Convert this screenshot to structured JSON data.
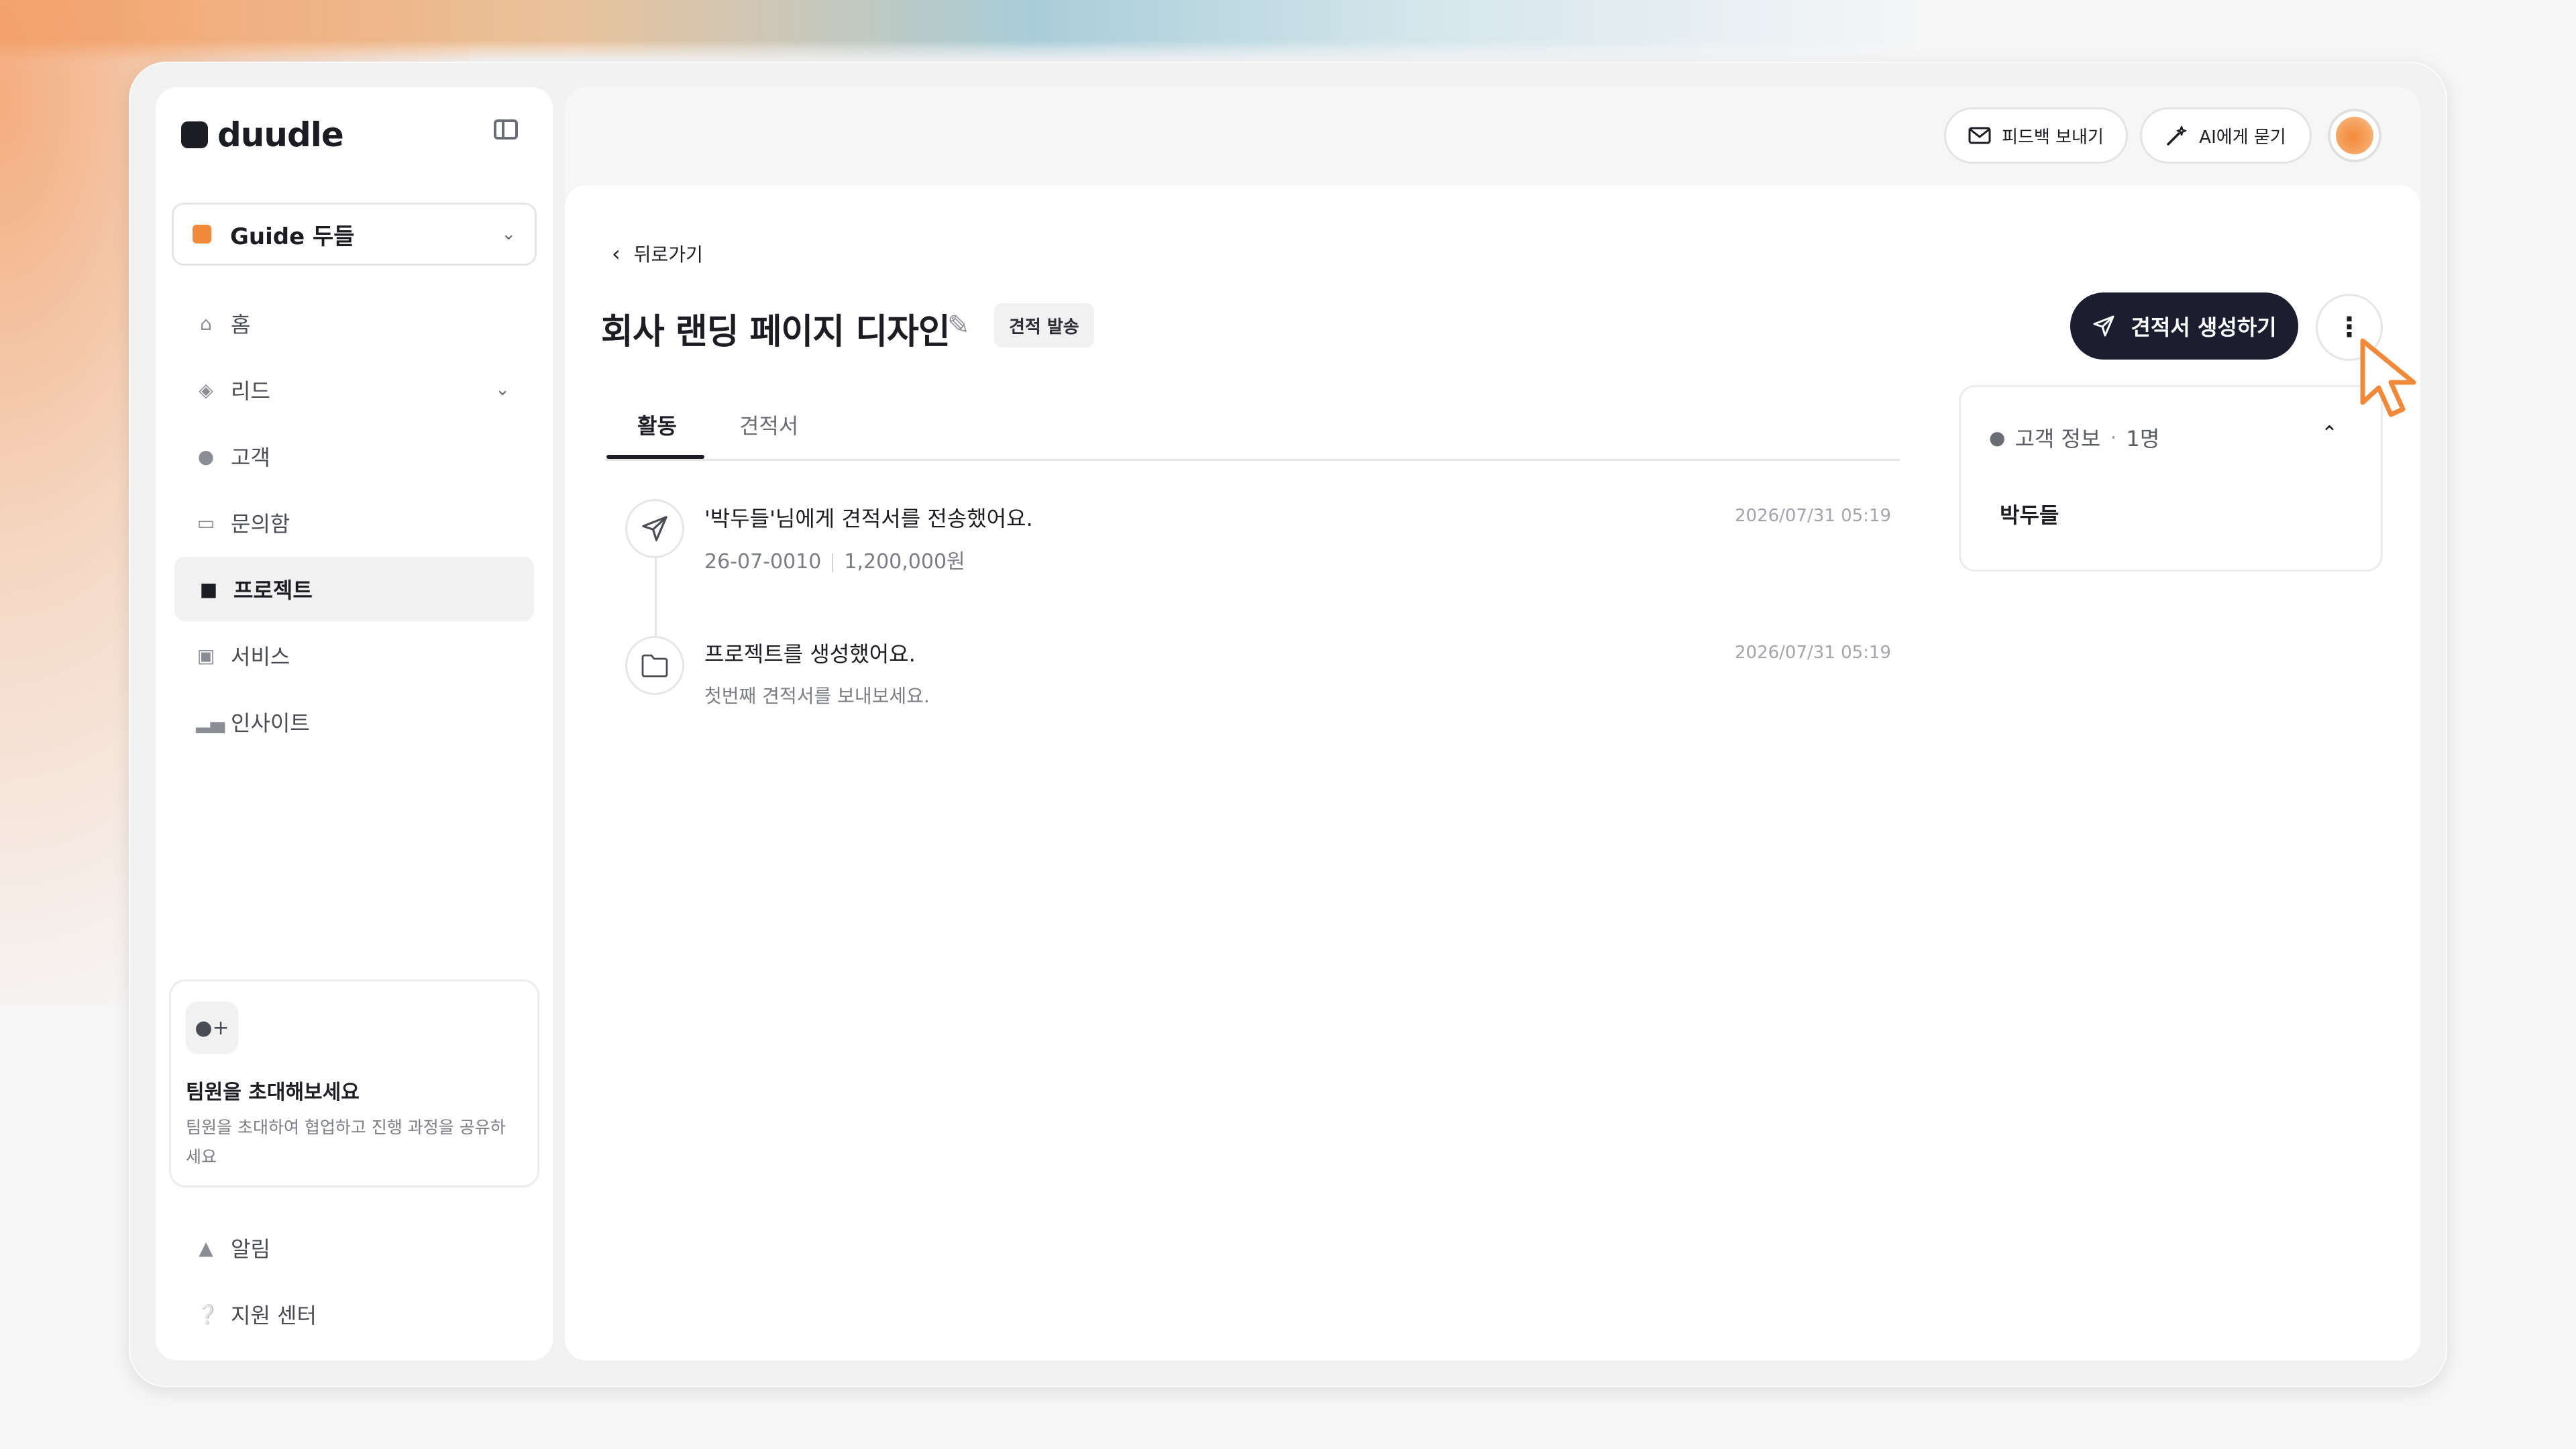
{
  "app": {
    "logo_text": "duudle"
  },
  "workspace": {
    "name": "Guide 두들",
    "accent": "#f08a3a"
  },
  "sidebar": {
    "items": [
      {
        "label": "홈",
        "icon": "home-icon"
      },
      {
        "label": "리드",
        "icon": "target-icon",
        "has_chevron": true
      },
      {
        "label": "고객",
        "icon": "person-icon"
      },
      {
        "label": "문의함",
        "icon": "inbox-icon"
      },
      {
        "label": "프로젝트",
        "icon": "folder-icon",
        "active": true
      },
      {
        "label": "서비스",
        "icon": "briefcase-icon"
      },
      {
        "label": "인사이트",
        "icon": "bar-chart-icon"
      }
    ],
    "invite": {
      "title": "팀원을 초대해보세요",
      "description": "팀원을 초대하여 협업하고 진행 과정을 공유하세요"
    },
    "bottom": [
      {
        "label": "알림",
        "icon": "bell-icon"
      },
      {
        "label": "지원 센터",
        "icon": "help-icon"
      }
    ]
  },
  "header": {
    "feedback_label": "피드백 보내기",
    "ai_label": "AI에게 묻기"
  },
  "page": {
    "back_label": "뒤로가기",
    "title": "회사 랜딩 페이지 디자인",
    "status_badge": "견적 발송",
    "primary_action": "견적서 생성하기"
  },
  "tabs": [
    {
      "label": "활동",
      "active": true
    },
    {
      "label": "견적서",
      "active": false
    }
  ],
  "activity": [
    {
      "icon": "send-icon",
      "title": "'박두들'님에게 견적서를 전송했어요.",
      "quote_no": "26-07-0010",
      "amount": "1,200,000원",
      "timestamp": "2026/07/31 05:19"
    },
    {
      "icon": "folder-icon",
      "title": "프로젝트를 생성했어요.",
      "subtitle": "첫번째 견적서를 보내보세요.",
      "timestamp": "2026/07/31 05:19"
    }
  ],
  "customer_panel": {
    "label": "고객 정보",
    "count": "1명",
    "customers": [
      "박두들"
    ]
  },
  "colors": {
    "primary_button": "#1c1d2e",
    "cursor_accent": "#f08a3a"
  }
}
